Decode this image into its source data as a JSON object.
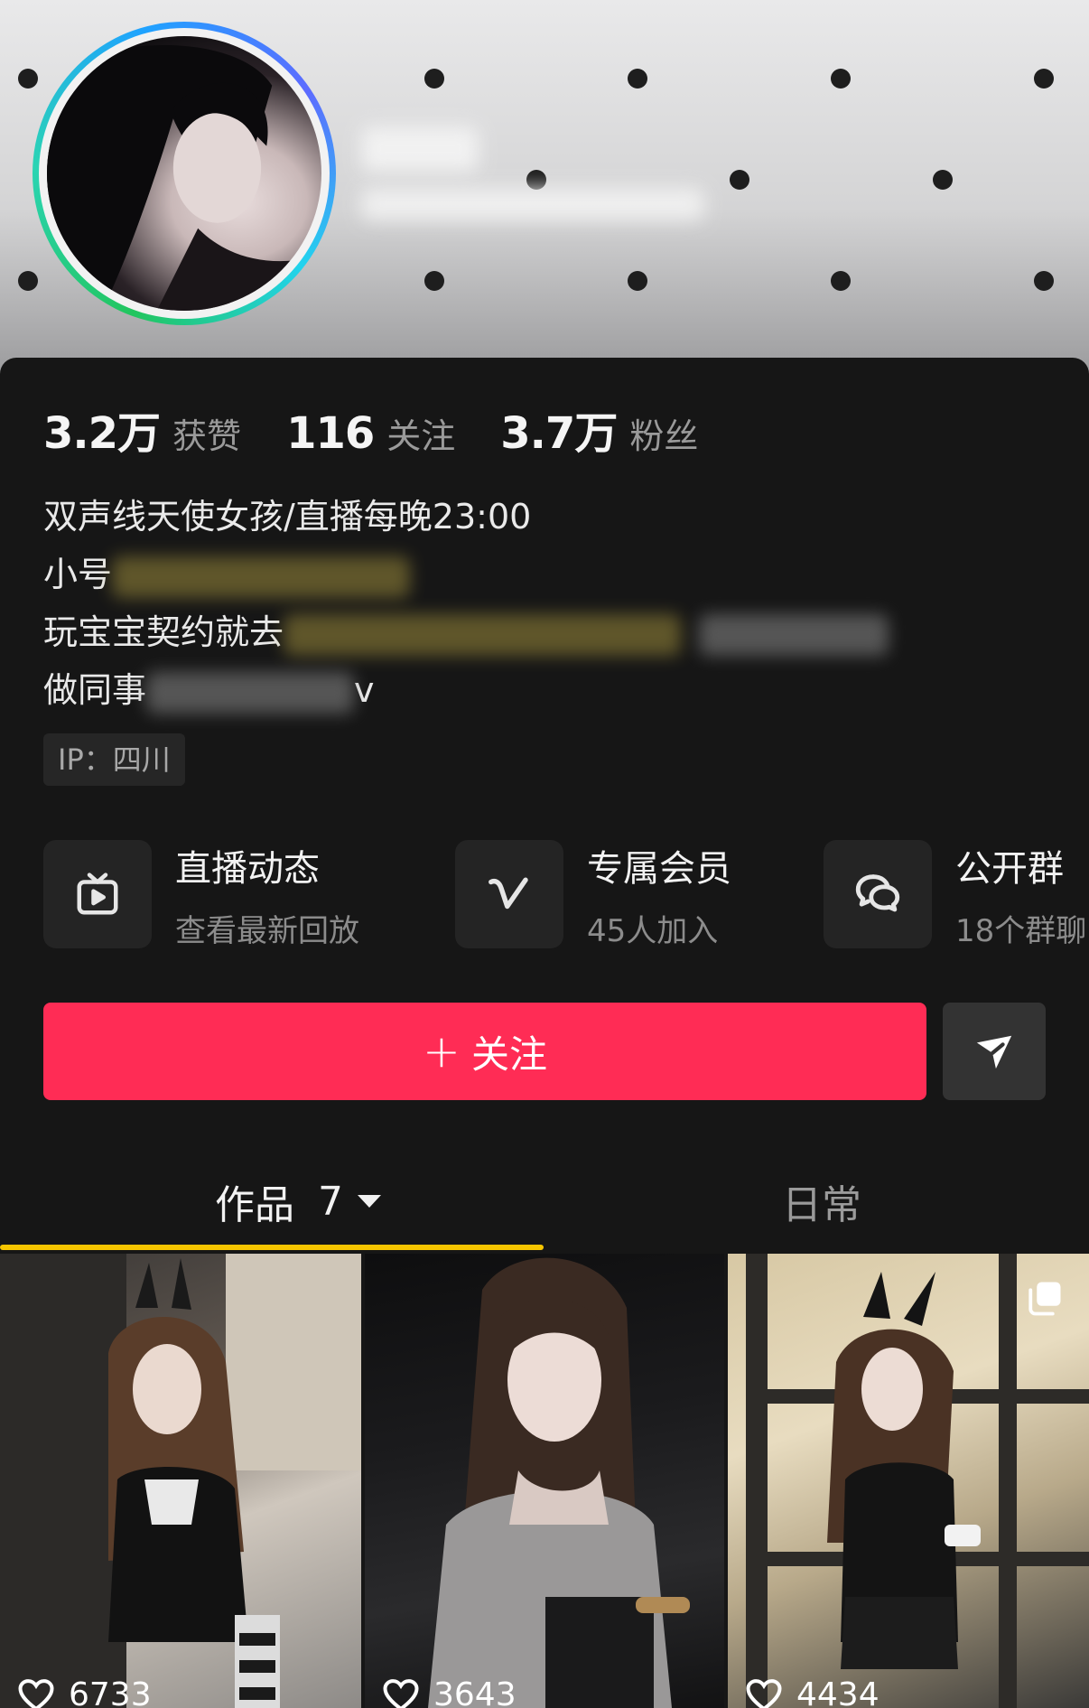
{
  "profile": {
    "stats": [
      {
        "value": "3.2万",
        "label": "获赞"
      },
      {
        "value": "116",
        "label": "关注"
      },
      {
        "value": "3.7万",
        "label": "粉丝"
      }
    ],
    "bio": {
      "line1": "双声线天使女孩/直播每晚23:00",
      "line2_prefix": "小号",
      "line3_prefix": "玩宝宝契约就去",
      "line4_prefix": "做同事",
      "line4_suffix": "v"
    },
    "ip": "IP：四川"
  },
  "features": [
    {
      "icon": "tv-play-icon",
      "title": "直播动态",
      "subtitle": "查看最新回放"
    },
    {
      "icon": "v-membership-icon",
      "title": "专属会员",
      "subtitle": "45人加入"
    },
    {
      "icon": "group-chat-icon",
      "title": "公开群",
      "subtitle": "18个群聊"
    }
  ],
  "actions": {
    "follow_label": "关注",
    "follow_plus": "+",
    "share_icon": "send-icon"
  },
  "tabs": {
    "works_label": "作品",
    "works_count": "7",
    "daily_label": "日常"
  },
  "videos": [
    {
      "likes": "6733"
    },
    {
      "likes": "3643"
    },
    {
      "likes": "4434"
    }
  ],
  "colors": {
    "follow": "#ff2c55",
    "tab_underline": "#f6c500",
    "background": "#161616"
  }
}
